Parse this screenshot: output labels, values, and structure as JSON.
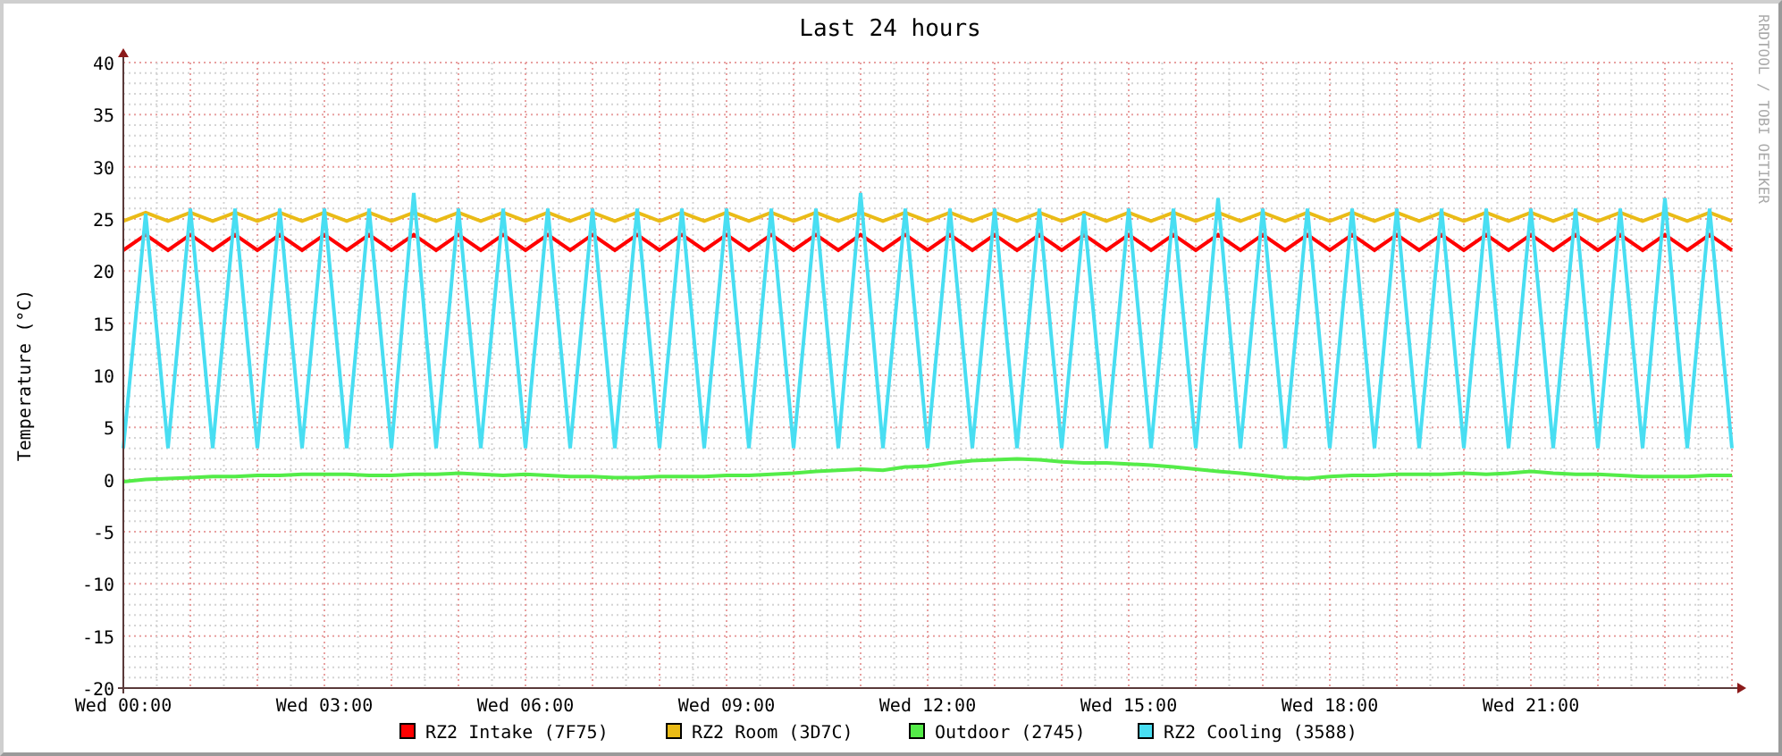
{
  "chart_data": {
    "type": "line",
    "title": "Last 24 hours",
    "ylabel": "Temperature (°C)",
    "ylim": [
      -20,
      40
    ],
    "grid": true,
    "legend": true,
    "categories": [
      "Wed 00:00",
      null,
      null,
      null,
      null,
      null,
      null,
      null,
      null,
      "Wed 03:00",
      null,
      null,
      null,
      null,
      null,
      null,
      null,
      null,
      "Wed 06:00",
      null,
      null,
      null,
      null,
      null,
      null,
      null,
      null,
      "Wed 09:00",
      null,
      null,
      null,
      null,
      null,
      null,
      null,
      null,
      "Wed 12:00",
      null,
      null,
      null,
      null,
      null,
      null,
      null,
      null,
      "Wed 15:00",
      null,
      null,
      null,
      null,
      null,
      null,
      null,
      null,
      "Wed 18:00",
      null,
      null,
      null,
      null,
      null,
      null,
      null,
      null,
      "Wed 21:00",
      null,
      null,
      null,
      null,
      null,
      null,
      null,
      null,
      null
    ],
    "yticks": [
      -20,
      -15,
      -10,
      -5,
      0,
      5,
      10,
      15,
      20,
      25,
      30,
      35,
      40
    ],
    "series": [
      {
        "name": "RZ2 Intake (7F75)",
        "color": "#ff0000",
        "values": [
          22,
          23.5,
          22,
          23.5,
          22,
          23.5,
          22,
          23.5,
          22,
          23.5,
          22,
          23.5,
          22,
          23.5,
          22,
          23.5,
          22,
          23.5,
          22,
          23.5,
          22,
          23.5,
          22,
          23.5,
          22,
          23.5,
          22,
          23.5,
          22,
          23.5,
          22,
          23.5,
          22,
          23.5,
          22,
          23.5,
          22,
          23.5,
          22,
          23.5,
          22,
          23.5,
          22,
          23.5,
          22,
          23.5,
          22,
          23.5,
          22,
          23.5,
          22,
          23.5,
          22,
          23.5,
          22,
          23.5,
          22,
          23.5,
          22,
          23.5,
          22,
          23.5,
          22,
          23.5,
          22,
          23.5,
          22,
          23.5,
          22,
          23.5,
          22,
          23.5,
          22
        ]
      },
      {
        "name": "RZ2 Room (3D7C)",
        "color": "#eabb16",
        "values": [
          24.8,
          25.6,
          24.8,
          25.6,
          24.8,
          25.6,
          24.8,
          25.6,
          24.8,
          25.6,
          24.8,
          25.6,
          24.8,
          25.6,
          24.8,
          25.6,
          24.8,
          25.6,
          24.8,
          25.6,
          24.8,
          25.6,
          24.8,
          25.6,
          24.8,
          25.6,
          24.8,
          25.6,
          24.8,
          25.6,
          24.8,
          25.6,
          24.8,
          25.6,
          24.8,
          25.6,
          24.8,
          25.6,
          24.8,
          25.6,
          24.8,
          25.6,
          24.8,
          25.6,
          24.8,
          25.6,
          24.8,
          25.6,
          24.8,
          25.6,
          24.8,
          25.6,
          24.8,
          25.6,
          24.8,
          25.6,
          24.8,
          25.6,
          24.8,
          25.6,
          24.8,
          25.6,
          24.8,
          25.6,
          24.8,
          25.6,
          24.8,
          25.6,
          24.8,
          25.6,
          24.8,
          25.6,
          24.8
        ]
      },
      {
        "name": "Outdoor (2745)",
        "color": "#54ec48",
        "values": [
          -0.2,
          0,
          0.1,
          0.2,
          0.3,
          0.3,
          0.4,
          0.4,
          0.5,
          0.5,
          0.5,
          0.4,
          0.4,
          0.5,
          0.5,
          0.6,
          0.5,
          0.4,
          0.5,
          0.4,
          0.3,
          0.3,
          0.2,
          0.2,
          0.3,
          0.3,
          0.3,
          0.4,
          0.4,
          0.5,
          0.6,
          0.8,
          0.9,
          1.0,
          0.9,
          1.2,
          1.3,
          1.6,
          1.8,
          1.9,
          2.0,
          1.9,
          1.7,
          1.6,
          1.6,
          1.5,
          1.4,
          1.2,
          1.0,
          0.8,
          0.6,
          0.4,
          0.2,
          0.1,
          0.3,
          0.4,
          0.4,
          0.5,
          0.5,
          0.5,
          0.6,
          0.5,
          0.6,
          0.8,
          0.6,
          0.5,
          0.5,
          0.4,
          0.3,
          0.3,
          0.3,
          0.4,
          0.4
        ]
      },
      {
        "name": "RZ2 Cooling (3588)",
        "color": "#48def2",
        "values": [
          3,
          25.5,
          3,
          26,
          3,
          26,
          3,
          26,
          3,
          26,
          3,
          26,
          3,
          27.5,
          3,
          26,
          3,
          26,
          3,
          26,
          3,
          26,
          3,
          26,
          3,
          26,
          3,
          26,
          3,
          26,
          3,
          26,
          3,
          27.5,
          3,
          26,
          3,
          26,
          3,
          26,
          3,
          26,
          3,
          25.5,
          3,
          26,
          3,
          26,
          3,
          27,
          3,
          26,
          3,
          26,
          3,
          26,
          3,
          26,
          3,
          26,
          3,
          26,
          3,
          26,
          3,
          26,
          3,
          26,
          3,
          27,
          3,
          26,
          3
        ]
      }
    ]
  },
  "side_credit": "RRDTOOL / TOBI OETIKER"
}
